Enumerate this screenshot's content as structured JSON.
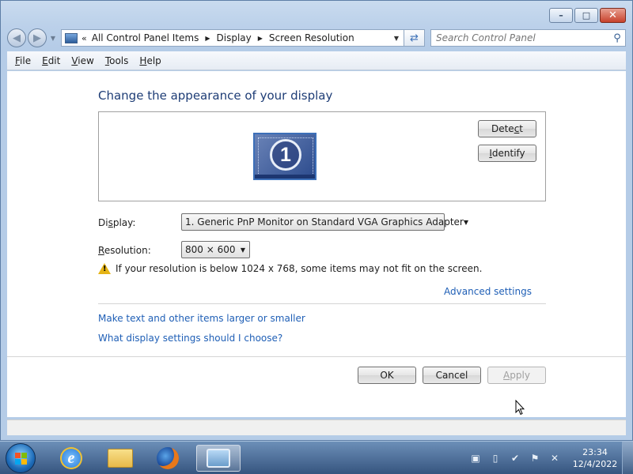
{
  "window": {
    "controls": {
      "minimize": "–",
      "maximize": "□",
      "close": "✕"
    }
  },
  "nav": {
    "back_icon": "back-arrow-icon",
    "forward_icon": "forward-arrow-icon",
    "address": {
      "prefix": "«",
      "crumbs": [
        "All Control Panel Items",
        "Display",
        "Screen Resolution"
      ],
      "separator": "▶"
    },
    "search_placeholder": "Search Control Panel"
  },
  "menu": [
    {
      "pre": "",
      "ul": "F",
      "post": "ile"
    },
    {
      "pre": "",
      "ul": "E",
      "post": "dit"
    },
    {
      "pre": "",
      "ul": "V",
      "post": "iew"
    },
    {
      "pre": "",
      "ul": "T",
      "post": "ools"
    },
    {
      "pre": "",
      "ul": "H",
      "post": "elp"
    }
  ],
  "main": {
    "heading": "Change the appearance of your display",
    "monitor_number": "1",
    "detect_pre": "Dete",
    "detect_ul": "c",
    "detect_post": "t",
    "identify_pre": "",
    "identify_ul": "I",
    "identify_post": "dentify",
    "display_label_pre": "Di",
    "display_label_ul": "s",
    "display_label_post": "play:",
    "display_value": "1. Generic PnP Monitor on Standard VGA Graphics Adapter",
    "resolution_label_pre": "",
    "resolution_label_ul": "R",
    "resolution_label_post": "esolution:",
    "resolution_value": "800 × 600",
    "warning": "If your resolution is below 1024 x 768, some items may not fit on the screen.",
    "advanced_link": "Advanced settings",
    "link_text_size": "Make text and other items larger or smaller",
    "link_which_settings": "What display settings should I choose?",
    "ok": "OK",
    "cancel": "Cancel",
    "apply_pre": "",
    "apply_ul": "A",
    "apply_post": "pply"
  },
  "taskbar": {
    "clock_time": "23:34",
    "clock_date": "12/4/2022",
    "pinned": [
      "internet-explorer-icon",
      "windows-explorer-icon",
      "firefox-icon",
      "control-panel-icon"
    ],
    "tray_icons": [
      "network-icon",
      "battery-icon",
      "security-icon",
      "action-center-flag-icon",
      "volume-muted-icon"
    ]
  },
  "colors": {
    "link": "#1f5fb6",
    "heading": "#1e3d76",
    "warning": "#e5b416"
  }
}
